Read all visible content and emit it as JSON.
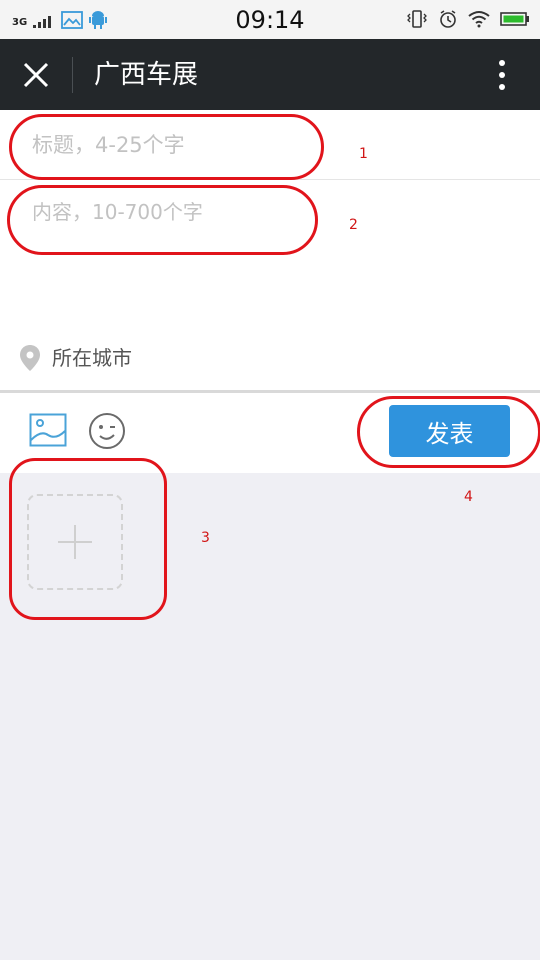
{
  "status_bar": {
    "network_label": "3G",
    "time": "09:14"
  },
  "header": {
    "title": "广西车展",
    "close_icon": "close-icon",
    "more_icon": "more-vertical-icon"
  },
  "form": {
    "title_placeholder": "标题，4-25个字",
    "content_placeholder": "内容，10-700个字",
    "city_label": "所在城市"
  },
  "toolbar": {
    "publish_label": "发表"
  },
  "annotations": [
    "1",
    "2",
    "3",
    "4"
  ],
  "colors": {
    "header_bg": "#23272a",
    "publish_button": "#2f93dd",
    "annotation": "#e1141b",
    "page_bg": "#efeff4"
  }
}
